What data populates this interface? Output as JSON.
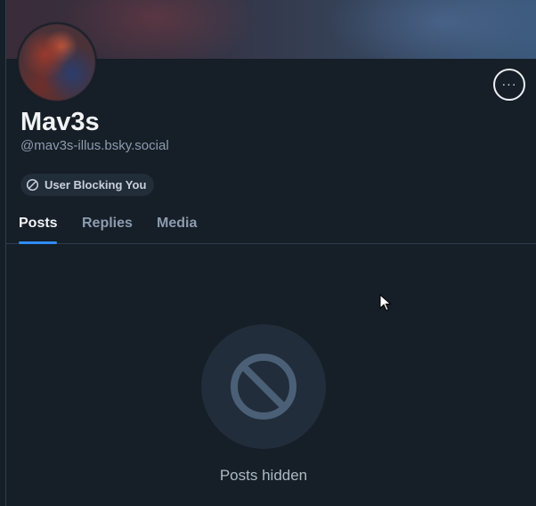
{
  "profile": {
    "display_name": "Mav3s",
    "handle": "@mav3s-illus.bsky.social",
    "block_badge": {
      "label": "User Blocking You",
      "icon": "block-icon"
    },
    "more_button": {
      "label": "···",
      "icon": "ellipsis-icon"
    }
  },
  "tabs": [
    {
      "label": "Posts",
      "active": true
    },
    {
      "label": "Replies",
      "active": false
    },
    {
      "label": "Media",
      "active": false
    }
  ],
  "empty_state": {
    "icon": "block-icon",
    "message": "Posts hidden"
  },
  "colors": {
    "background": "#161e27",
    "accent": "#2f8cf5",
    "muted_text": "#8c9caf"
  }
}
